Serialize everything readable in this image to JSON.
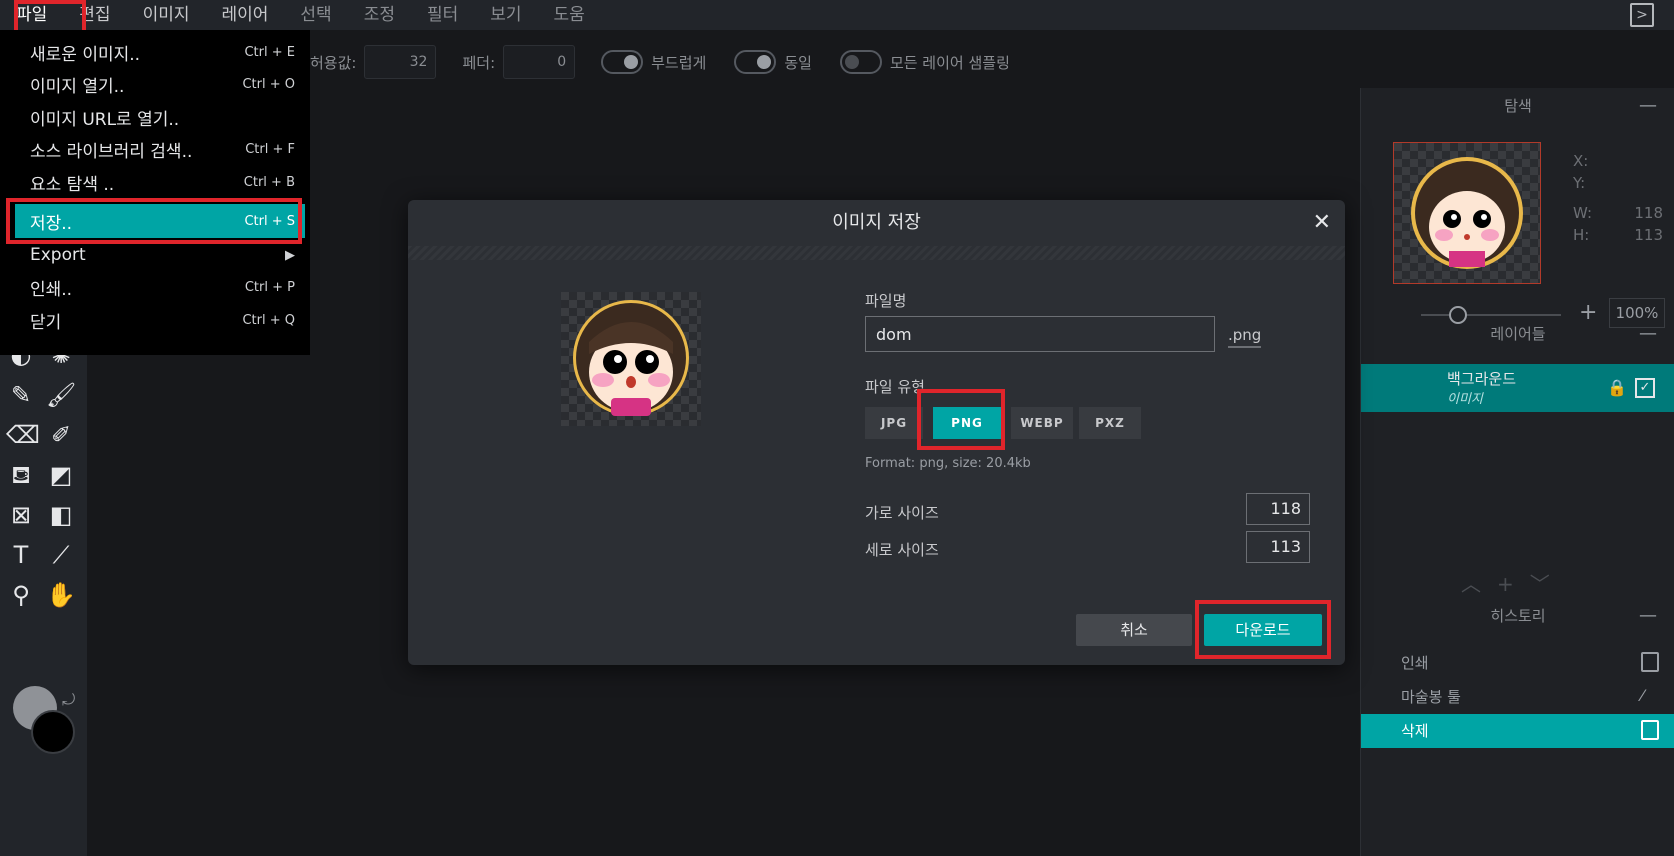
{
  "menubar": {
    "items": [
      "파일",
      "편집",
      "이미지",
      "레이어",
      "선택",
      "조정",
      "필터",
      "보기",
      "도움"
    ]
  },
  "options": {
    "tolerance_label": "허용값:",
    "tolerance_value": "32",
    "feather_label": "페더:",
    "feather_value": "0",
    "smooth_label": "부드럽게",
    "contiguous_label": "동일",
    "all_layers_label": "모든 레이어 샘플링"
  },
  "file_menu": {
    "items": [
      {
        "label": "새로운 이미지..",
        "shortcut": "Ctrl + E"
      },
      {
        "label": "이미지 열기..",
        "shortcut": "Ctrl + O"
      },
      {
        "label": "이미지 URL로 열기..",
        "shortcut": ""
      },
      {
        "label": "소스 라이브러리 검색..",
        "shortcut": "Ctrl + F"
      },
      {
        "label": "요소 탐색 ..",
        "shortcut": "Ctrl + B"
      },
      {
        "label": "저장..",
        "shortcut": "Ctrl + S"
      },
      {
        "label": "Export",
        "shortcut": "▶"
      },
      {
        "label": "인쇄..",
        "shortcut": "Ctrl + P"
      },
      {
        "label": "닫기",
        "shortcut": "Ctrl + Q"
      }
    ]
  },
  "navigator": {
    "title": "탐색",
    "x_label": "X:",
    "y_label": "Y:",
    "w_label": "W:",
    "w_value": "118",
    "h_label": "H:",
    "h_value": "113",
    "zoom": "100%"
  },
  "layers": {
    "title": "레이어들",
    "items": [
      {
        "name": "백그라운드",
        "type": "이미지"
      }
    ]
  },
  "history": {
    "title": "히스토리",
    "items": [
      "인쇄",
      "마술봉 툴",
      "삭제"
    ]
  },
  "dialog": {
    "title": "이미지 저장",
    "filename_label": "파일명",
    "filename_value": "dom",
    "extension": ".png",
    "filetype_label": "파일 유형",
    "types": [
      "JPG",
      "PNG",
      "WEBP",
      "PXZ"
    ],
    "selected_type": "PNG",
    "format_info": "Format: png, size: 20.4kb",
    "width_label": "가로 사이즈",
    "width_value": "118",
    "height_label": "세로 사이즈",
    "height_value": "113",
    "cancel_label": "취소",
    "download_label": "다운로드"
  },
  "colors": {
    "accent": "#00a5a5",
    "highlight_box": "#e0252b",
    "foreground_swatch": "#8f9297",
    "background_swatch": "#000000"
  }
}
